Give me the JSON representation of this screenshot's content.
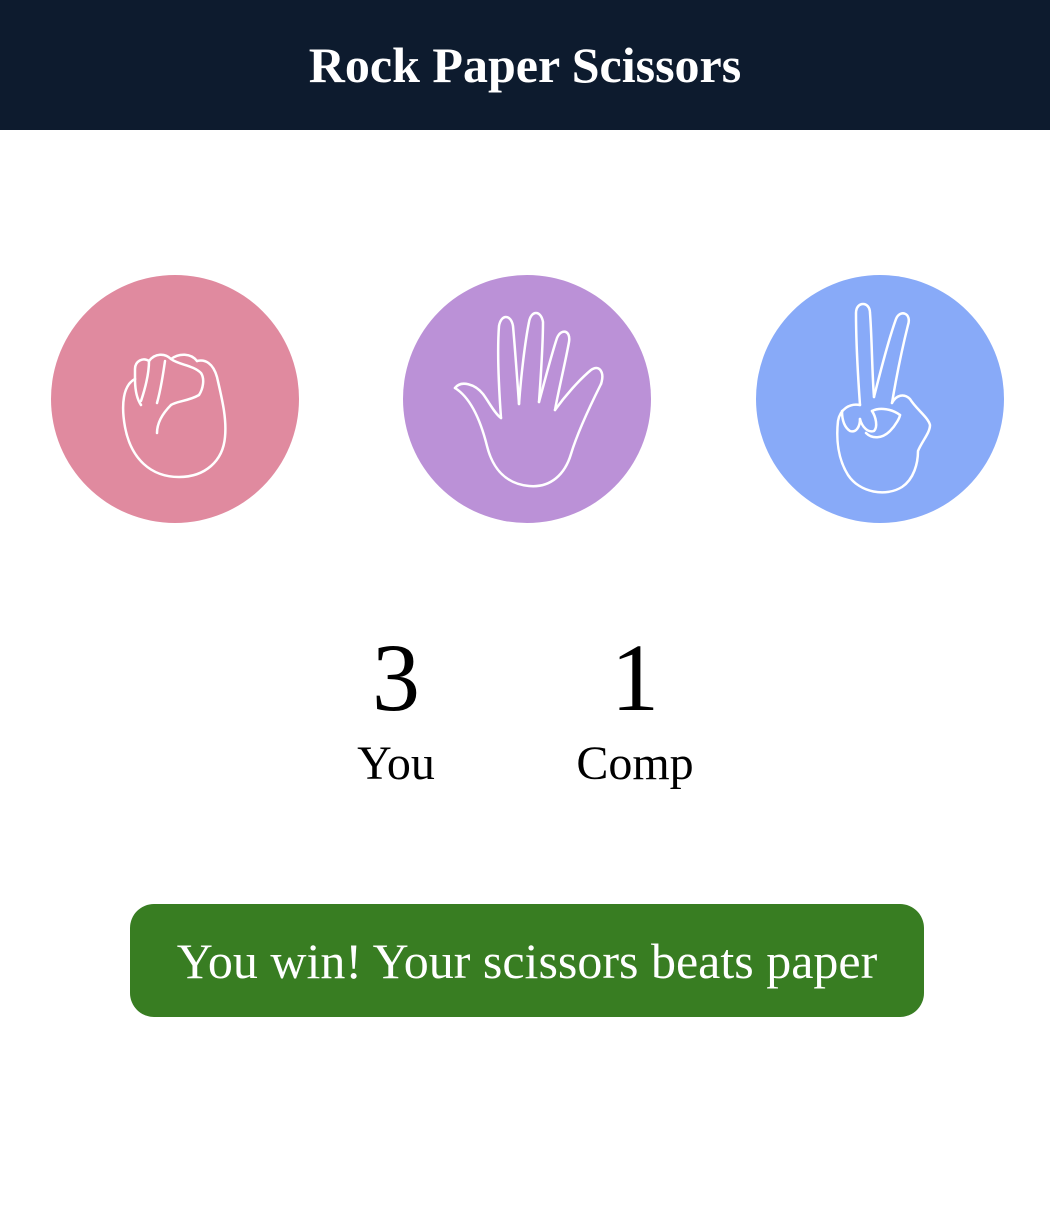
{
  "header": {
    "title": "Rock Paper Scissors"
  },
  "choices": [
    {
      "id": "rock",
      "icon": "fist-icon",
      "color": "#e08a9f"
    },
    {
      "id": "paper",
      "icon": "open-hand-icon",
      "color": "#bb91d7"
    },
    {
      "id": "scissors",
      "icon": "peace-hand-icon",
      "color": "#88aaf8"
    }
  ],
  "scoreboard": {
    "user": {
      "value": "3",
      "label": "You"
    },
    "comp": {
      "value": "1",
      "label": "Comp"
    }
  },
  "result": {
    "message": "You win! Your scissors beats paper",
    "color": "#387d22"
  },
  "colors": {
    "header_bg": "#0d1b2e",
    "text_light": "#ffffff"
  }
}
